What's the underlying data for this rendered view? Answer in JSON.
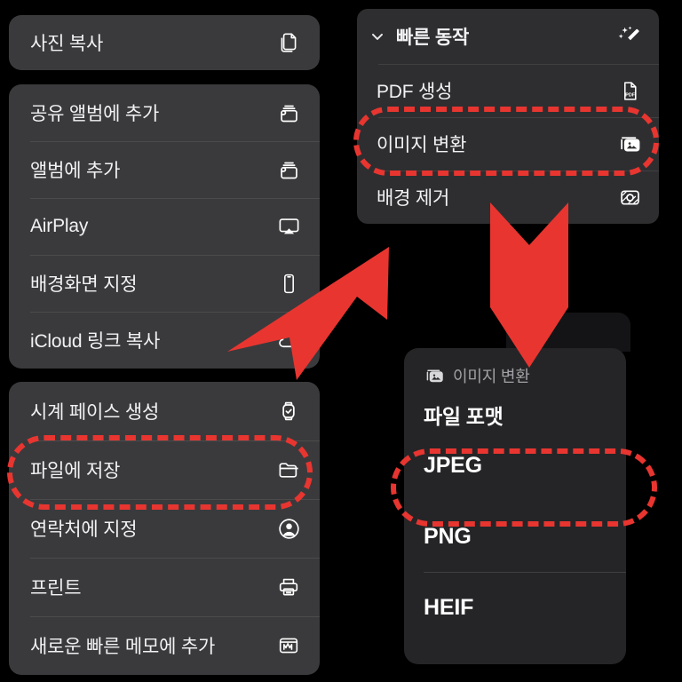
{
  "theme": {
    "background": "#000000",
    "panel_bg": "#3a3a3c",
    "panel_dark_bg": "#252527",
    "panel_topright_bg": "#2e2e30",
    "text_primary": "#f2f2f4",
    "text_secondary": "#a2a2a6",
    "annotation_red": "#e83530"
  },
  "left_menu": {
    "groups": [
      {
        "name": "copy-group",
        "items": [
          {
            "label": "사진 복사",
            "icon": "copy-photo-icon"
          }
        ]
      },
      {
        "name": "share-group",
        "items": [
          {
            "label": "공유 앨범에 추가",
            "icon": "shared-album-icon"
          },
          {
            "label": "앨범에 추가",
            "icon": "album-icon"
          },
          {
            "label": "AirPlay",
            "icon": "airplay-icon"
          },
          {
            "label": "배경화면 지정",
            "icon": "wallpaper-iphone-icon"
          },
          {
            "label": "iCloud 링크 복사",
            "icon": "icloud-link-icon"
          }
        ]
      },
      {
        "name": "actions-group",
        "items": [
          {
            "label": "시계 페이스 생성",
            "icon": "watch-face-icon"
          },
          {
            "label": "파일에 저장",
            "icon": "folder-icon"
          },
          {
            "label": "연락처에 지정",
            "icon": "contact-person-icon"
          },
          {
            "label": "프린트",
            "icon": "printer-icon"
          },
          {
            "label": "새로운 빠른 메모에 추가",
            "icon": "quick-note-icon"
          }
        ]
      }
    ]
  },
  "quick_actions": {
    "header": {
      "label": "빠른 동작",
      "chevron_icon": "chevron-down-icon",
      "trailing_icon": "magic-wand-sparkles-icon"
    },
    "items": [
      {
        "label": "PDF 생성",
        "icon": "pdf-document-icon"
      },
      {
        "label": "이미지 변환",
        "icon": "convert-image-icon"
      },
      {
        "label": "배경 제거",
        "icon": "remove-background-icon"
      }
    ]
  },
  "format_panel": {
    "header": {
      "label": "이미지 변환",
      "icon": "convert-image-icon"
    },
    "section_title": "파일 포맷",
    "options": [
      {
        "label": "JPEG"
      },
      {
        "label": "PNG"
      },
      {
        "label": "HEIF"
      }
    ]
  },
  "annotations": {
    "ovals": [
      {
        "name": "save-to-files",
        "target": "파일에 저장"
      },
      {
        "name": "convert-image",
        "target": "이미지 변환"
      },
      {
        "name": "jpeg",
        "target": "JPEG"
      }
    ],
    "arrows": [
      {
        "name": "diagonal-arrow",
        "direction": "down-left"
      },
      {
        "name": "down-arrow",
        "direction": "down"
      }
    ]
  }
}
